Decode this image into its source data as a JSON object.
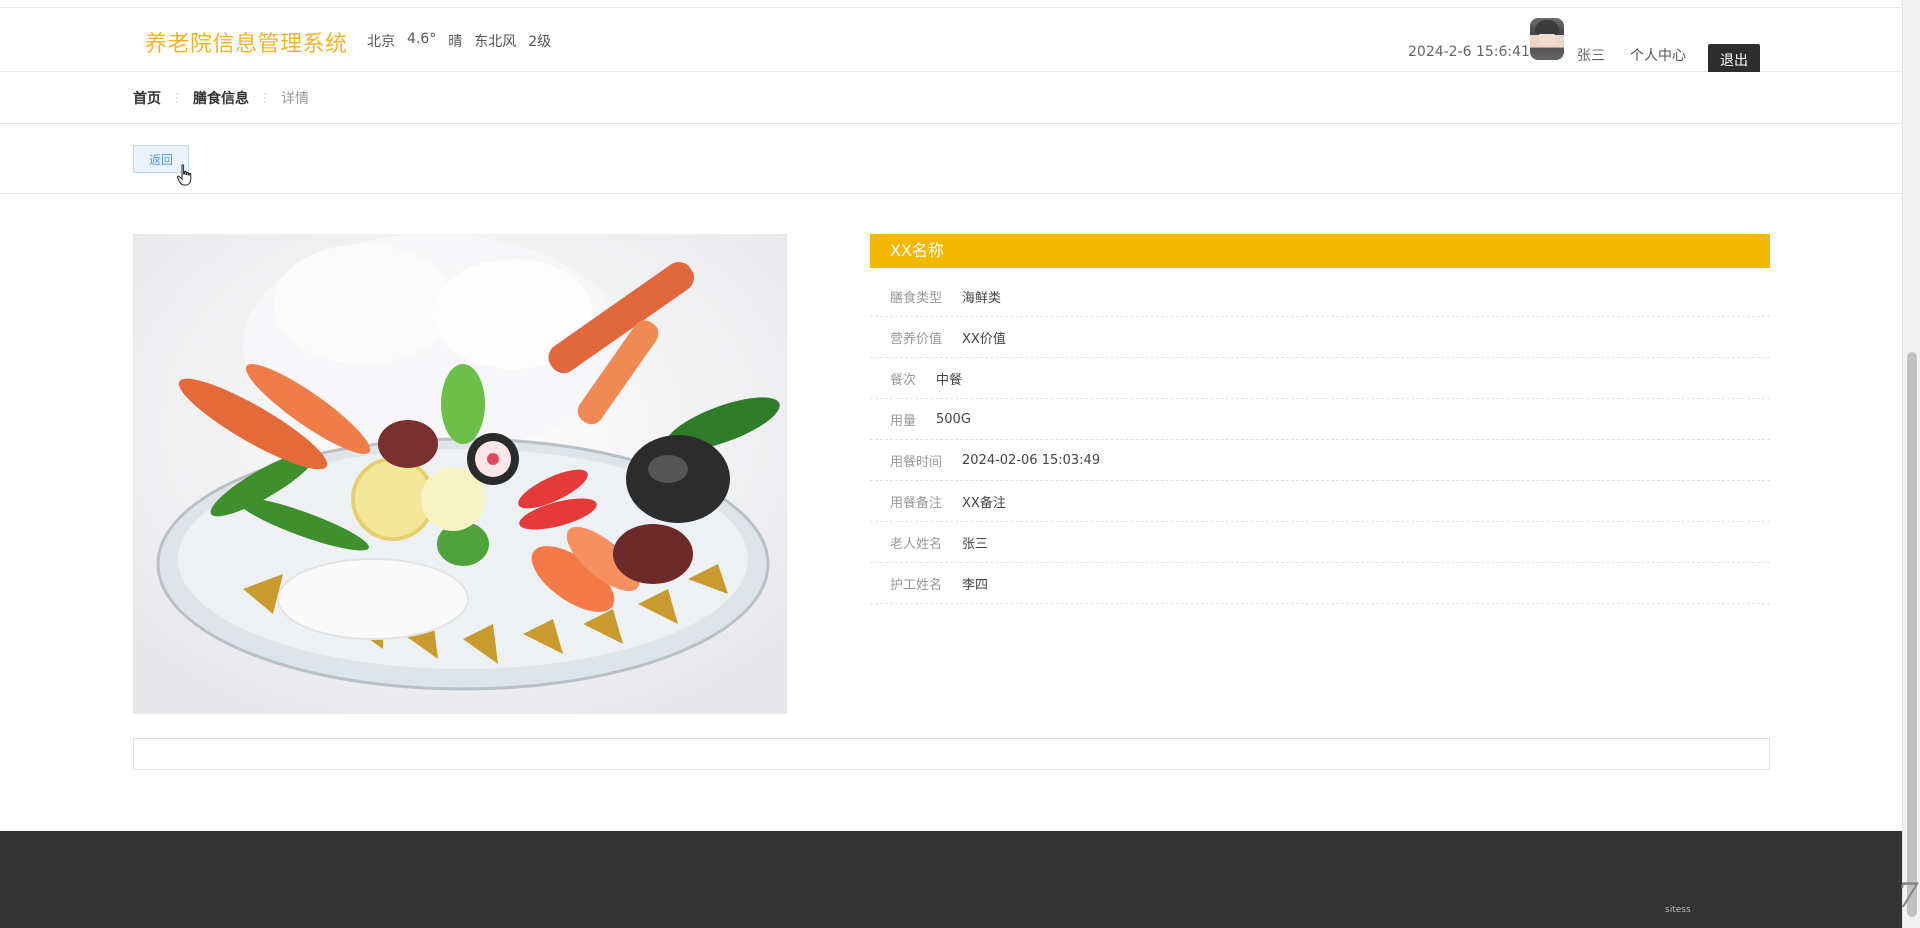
{
  "header": {
    "site_title": "养老院信息管理系统",
    "weather": {
      "city": "北京",
      "temperature": "4.6°",
      "condition": "晴",
      "wind": "东北风",
      "wind_level": "2级"
    },
    "clock": "2024-2-6 15:6:41",
    "username": "张三",
    "profile_label": "个人中心",
    "logout_label": "退出"
  },
  "breadcrumb": {
    "home": "首页",
    "section": "膳食信息",
    "current": "详情"
  },
  "actions": {
    "back_label": "返回"
  },
  "detail": {
    "title": "XX名称",
    "rows": [
      {
        "label": "膳食类型",
        "value": "海鲜类"
      },
      {
        "label": "营养价值",
        "value": "XX价值"
      },
      {
        "label": "餐次",
        "value": "中餐"
      },
      {
        "label": "用量",
        "value": "500G"
      },
      {
        "label": "用餐时间",
        "value": "2024-02-06 15:03:49"
      },
      {
        "label": "用餐备注",
        "value": "XX备注"
      },
      {
        "label": "老人姓名",
        "value": "张三"
      },
      {
        "label": "护工姓名",
        "value": "李四"
      }
    ]
  },
  "colors": {
    "brand": "#f0b429",
    "title_bar": "#f2b700",
    "footer": "#333333",
    "logout_button": "#2d2d2d",
    "back_button_text": "#4c9be0"
  },
  "icons": {
    "cursor": "hand-pointer-icon",
    "avatar": "user-avatar"
  },
  "footer": {
    "mark": "sitess"
  }
}
